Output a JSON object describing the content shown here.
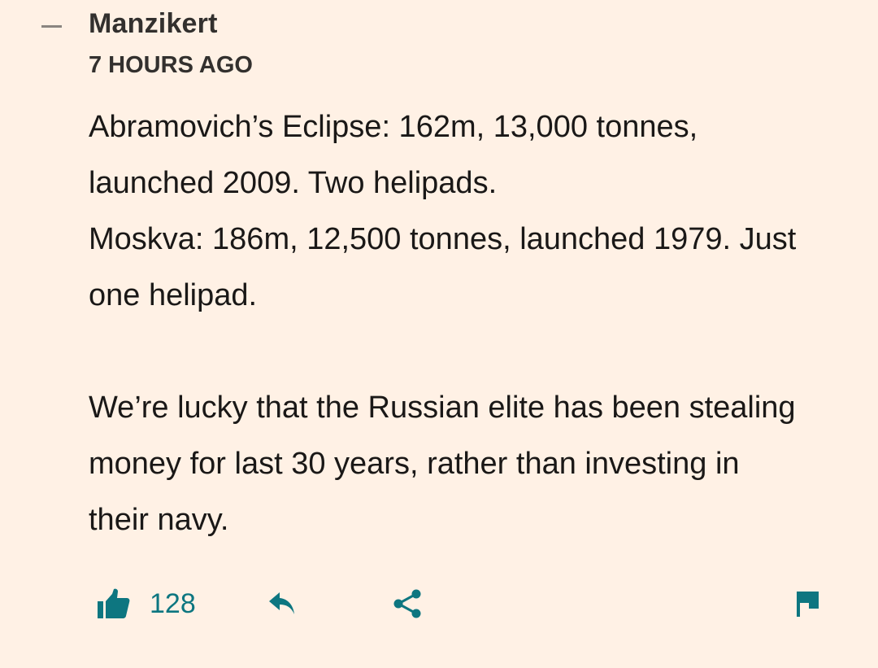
{
  "comment": {
    "author": "Manzikert",
    "timestamp": "7 HOURS AGO",
    "paragraphs": [
      "Abramovich’s Eclipse: 162m, 13,000 tonnes,",
      "launched 2009. Two helipads.",
      "Moskva: 186m, 12,500 tonnes, launched 1979. Just",
      "one helipad.",
      "We’re lucky that the Russian elite has been stealing",
      "money for last 30 years, rather than investing in",
      "their navy."
    ],
    "likes": "128"
  },
  "icons": {
    "collapse": "minus-icon",
    "like": "thumbs-up-icon",
    "reply": "reply-arrow-icon",
    "share": "share-icon",
    "report": "flag-icon"
  },
  "colors": {
    "background": "#fff1e5",
    "accent": "#0d7680",
    "text": "#1a1817",
    "meta": "#33302e"
  }
}
